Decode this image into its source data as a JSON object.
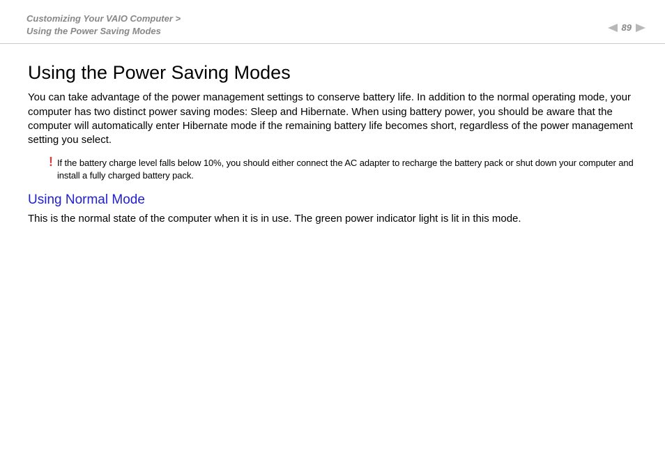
{
  "header": {
    "breadcrumb_line1": "Customizing Your VAIO Computer >",
    "breadcrumb_line2": "Using the Power Saving Modes",
    "page_number": "89"
  },
  "main": {
    "title": "Using the Power Saving Modes",
    "intro": "You can take advantage of the power management settings to conserve battery life. In addition to the normal operating mode, your computer has two distinct power saving modes: Sleep and Hibernate. When using battery power, you should be aware that the computer will automatically enter Hibernate mode if the remaining battery life becomes short, regardless of the power management setting you select.",
    "warning_mark": "!",
    "warning_text": "If the battery charge level falls below 10%, you should either connect the AC adapter to recharge the battery pack or shut down your computer and install a fully charged battery pack.",
    "section_heading": "Using Normal Mode",
    "section_body": "This is the normal state of the computer when it is in use. The green power indicator light is lit in this mode."
  },
  "colors": {
    "breadcrumb": "#888888",
    "link": "#2020d0",
    "warning": "#d04040"
  }
}
